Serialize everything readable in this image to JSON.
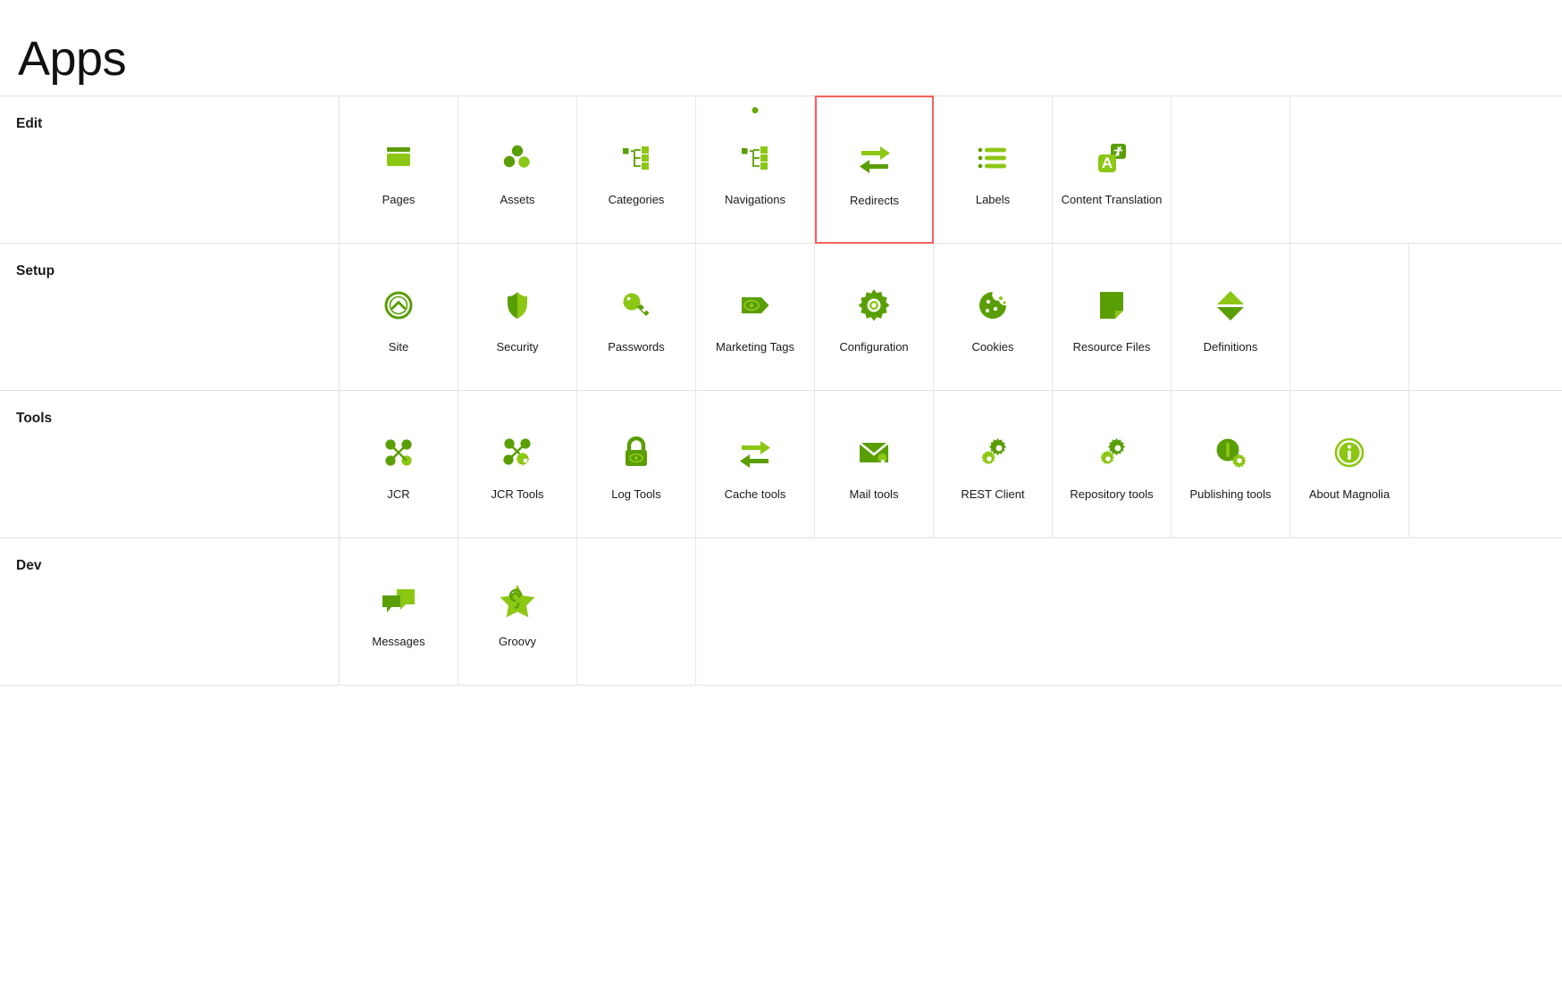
{
  "header": {
    "title": "Apps"
  },
  "colors": {
    "brand_light_green": "#8CC714",
    "brand_dark_green": "#5A9E06",
    "selection_red": "#F4615F",
    "grid_line": "#E2E2E2",
    "text": "#1A1A1A"
  },
  "groups": [
    {
      "name": "Edit",
      "tiles": [
        {
          "label": "Pages",
          "icon": "pages-icon",
          "selected": false,
          "badge": false
        },
        {
          "label": "Assets",
          "icon": "assets-icon",
          "selected": false,
          "badge": false
        },
        {
          "label": "Categories",
          "icon": "categories-icon",
          "selected": false,
          "badge": false
        },
        {
          "label": "Navigations",
          "icon": "navigations-icon",
          "selected": false,
          "badge": true
        },
        {
          "label": "Redirects",
          "icon": "redirects-icon",
          "selected": true,
          "badge": false
        },
        {
          "label": "Labels",
          "icon": "labels-icon",
          "selected": false,
          "badge": false
        },
        {
          "label": "Content Translation",
          "icon": "content-translation-icon",
          "selected": false,
          "badge": false
        }
      ]
    },
    {
      "name": "Setup",
      "tiles": [
        {
          "label": "Site",
          "icon": "site-icon",
          "selected": false,
          "badge": false
        },
        {
          "label": "Security",
          "icon": "security-icon",
          "selected": false,
          "badge": false
        },
        {
          "label": "Passwords",
          "icon": "passwords-icon",
          "selected": false,
          "badge": false
        },
        {
          "label": "Marketing Tags",
          "icon": "marketing-tags-icon",
          "selected": false,
          "badge": false
        },
        {
          "label": "Configuration",
          "icon": "configuration-icon",
          "selected": false,
          "badge": false
        },
        {
          "label": "Cookies",
          "icon": "cookies-icon",
          "selected": false,
          "badge": false
        },
        {
          "label": "Resource Files",
          "icon": "resource-files-icon",
          "selected": false,
          "badge": false
        },
        {
          "label": "Definitions",
          "icon": "definitions-icon",
          "selected": false,
          "badge": false
        }
      ]
    },
    {
      "name": "Tools",
      "tiles": [
        {
          "label": "JCR",
          "icon": "jcr-icon",
          "selected": false,
          "badge": false
        },
        {
          "label": "JCR Tools",
          "icon": "jcr-tools-icon",
          "selected": false,
          "badge": false
        },
        {
          "label": "Log Tools",
          "icon": "log-tools-icon",
          "selected": false,
          "badge": false
        },
        {
          "label": "Cache tools",
          "icon": "cache-tools-icon",
          "selected": false,
          "badge": false
        },
        {
          "label": "Mail tools",
          "icon": "mail-tools-icon",
          "selected": false,
          "badge": false
        },
        {
          "label": "REST Client",
          "icon": "rest-client-icon",
          "selected": false,
          "badge": false
        },
        {
          "label": "Repository tools",
          "icon": "repository-tools-icon",
          "selected": false,
          "badge": false
        },
        {
          "label": "Publishing tools",
          "icon": "publishing-tools-icon",
          "selected": false,
          "badge": false
        },
        {
          "label": "About Magnolia",
          "icon": "about-magnolia-icon",
          "selected": false,
          "badge": false
        }
      ]
    },
    {
      "name": "Dev",
      "tiles": [
        {
          "label": "Messages",
          "icon": "messages-icon",
          "selected": false,
          "badge": false
        },
        {
          "label": "Groovy",
          "icon": "groovy-icon",
          "selected": false,
          "badge": false
        }
      ]
    }
  ]
}
